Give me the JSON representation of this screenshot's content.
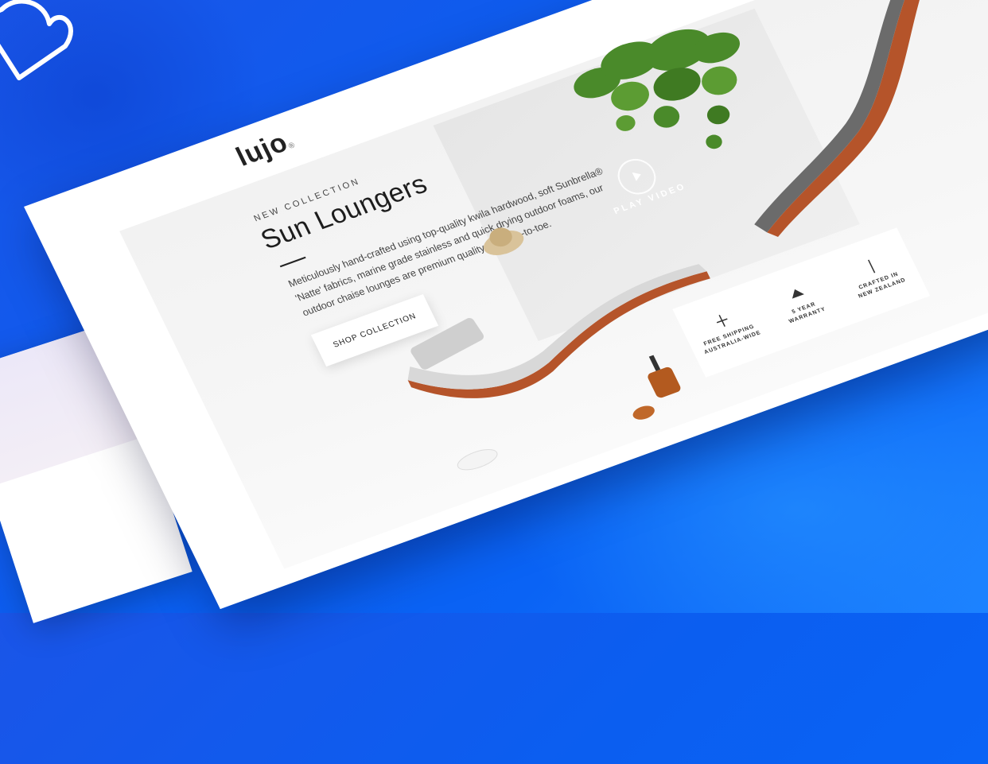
{
  "site": {
    "logo": "lujo",
    "logo_mark": "®",
    "hero": {
      "eyebrow": "NEW COLLECTION",
      "title": "Sun Loungers",
      "description": "Meticulously hand-crafted using top-quality kwila hardwood, soft Sunbrella® 'Natte' fabrics, marine grade stainless and quick drying outdoor foams, our outdoor chaise lounges are premium quality from top-to-toe.",
      "cta": "SHOP COLLECTION",
      "video_label": "PLAY VIDEO"
    },
    "features": [
      {
        "icon": "shipping-icon",
        "label": "FREE SHIPPING",
        "sublabel": "AUSTRALIA-WIDE"
      },
      {
        "icon": "warranty-icon",
        "label": "5 YEAR",
        "sublabel": "WARRANTY"
      },
      {
        "icon": "crafted-icon",
        "label": "CRAFTED IN",
        "sublabel": "NEW ZEALAND"
      }
    ]
  },
  "decor": {
    "heart": "heart-icon"
  },
  "colors": {
    "background": "#0b5ef0",
    "wood": "#b5542a",
    "cushion_light": "#d8d8d8",
    "cushion_dark": "#6b6b6b"
  }
}
